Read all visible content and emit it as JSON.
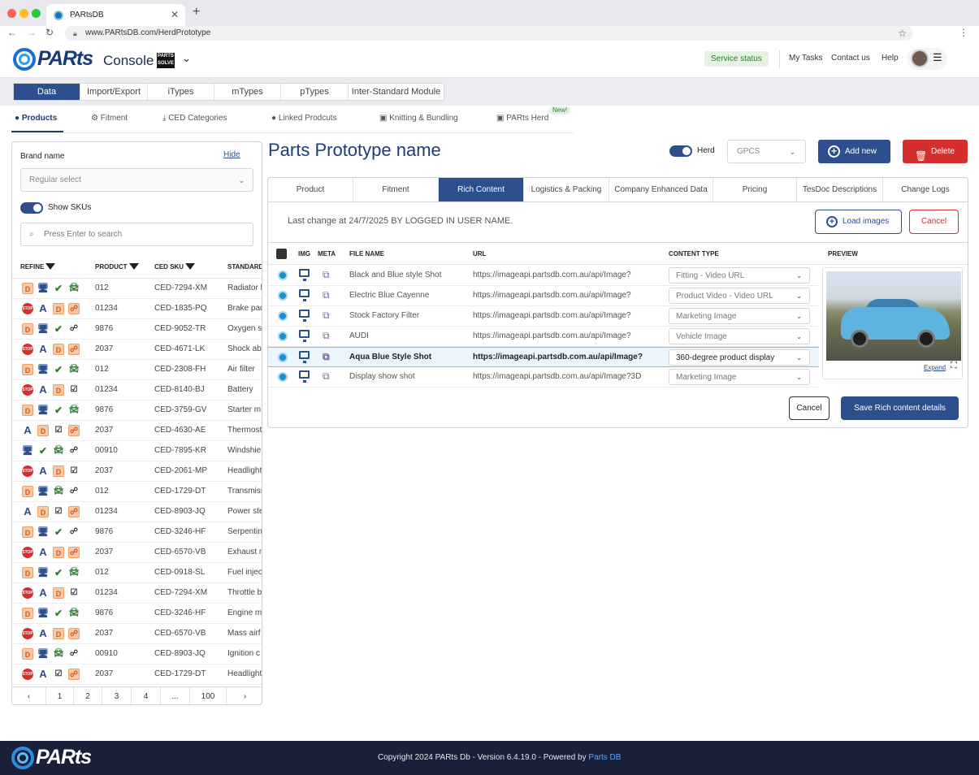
{
  "browser": {
    "tab_title": "PARtsDB",
    "url": "www.PARtsDB.com/HerdPrototype"
  },
  "header": {
    "logo": "PARts",
    "console": "Console",
    "console_badge": "PARTS SOLVE",
    "service_status": "Service status",
    "links": [
      "My Tasks",
      "Contact us",
      "Help"
    ]
  },
  "top_nav": [
    "Data",
    "Import/Export",
    "iTypes",
    "mTypes",
    "pTypes",
    "Inter-Standard Module"
  ],
  "sub_tabs": [
    "Products",
    "Fitment",
    "CED Categories",
    "Linked Prodcuts",
    "Knitting & Bundling",
    "PARts Herd"
  ],
  "new_tag": "New!",
  "left_panel": {
    "brand_label": "Brand name",
    "hide": "Hide",
    "select_placeholder": "Regular select",
    "show_skus": "Show SKUs",
    "search_placeholder": "Press Enter to search",
    "headers": [
      "REFINE",
      "PRODUCT",
      "CED SKU",
      "STANDARD"
    ],
    "rows": [
      {
        "icons": [
          "D",
          "monitor",
          "check",
          "car"
        ],
        "product": "012",
        "sku": "CED-7294-XM",
        "std": "Radiator h"
      },
      {
        "icons": [
          "stop",
          "A",
          "D",
          "net-orange"
        ],
        "product": "01234",
        "sku": "CED-1835-PQ",
        "std": "Brake pad"
      },
      {
        "icons": [
          "D",
          "monitor",
          "check",
          "net"
        ],
        "product": "9876",
        "sku": "CED-9052-TR",
        "std": "Oxygen se"
      },
      {
        "icons": [
          "stop",
          "A",
          "D",
          "net-orange"
        ],
        "product": "2037",
        "sku": "CED-4671-LK",
        "std": "Shock abs"
      },
      {
        "icons": [
          "D",
          "monitor",
          "check",
          "car"
        ],
        "product": "012",
        "sku": "CED-2308-FH",
        "std": "Air filter"
      },
      {
        "icons": [
          "stop",
          "A",
          "D",
          "sheet"
        ],
        "product": "01234",
        "sku": "CED-8140-BJ",
        "std": "Battery"
      },
      {
        "icons": [
          "D",
          "monitor",
          "check",
          "car"
        ],
        "product": "9876",
        "sku": "CED-3759-GV",
        "std": "Starter m"
      },
      {
        "icons": [
          "A",
          "D",
          "sheet",
          "net-orange"
        ],
        "product": "2037",
        "sku": "CED-4630-AE",
        "std": "Thermost"
      },
      {
        "icons": [
          "monitor",
          "check",
          "car",
          "net"
        ],
        "product": "00910",
        "sku": "CED-7895-KR",
        "std": "Windshie"
      },
      {
        "icons": [
          "stop",
          "A",
          "D",
          "sheet"
        ],
        "product": "2037",
        "sku": "CED-2061-MP",
        "std": "Headlight"
      },
      {
        "icons": [
          "D",
          "monitor",
          "car",
          "net"
        ],
        "product": "012",
        "sku": "CED-1729-DT",
        "std": "Transmiss"
      },
      {
        "icons": [
          "A",
          "D",
          "sheet",
          "net-orange"
        ],
        "product": "01234",
        "sku": "CED-8903-JQ",
        "std": "Power ste"
      },
      {
        "icons": [
          "D",
          "monitor",
          "check",
          "net"
        ],
        "product": "9876",
        "sku": "CED-3246-HF",
        "std": "Serpentin"
      },
      {
        "icons": [
          "stop",
          "A",
          "D",
          "net-orange"
        ],
        "product": "2037",
        "sku": "CED-6570-VB",
        "std": "Exhaust m"
      },
      {
        "icons": [
          "D",
          "monitor",
          "check",
          "car"
        ],
        "product": "012",
        "sku": "CED-0918-SL",
        "std": "Fuel injec"
      },
      {
        "icons": [
          "stop",
          "A",
          "D",
          "sheet"
        ],
        "product": "01234",
        "sku": "CED-7294-XM",
        "std": "Throttle b"
      },
      {
        "icons": [
          "D",
          "monitor",
          "check",
          "car"
        ],
        "product": "9876",
        "sku": "CED-3246-HF",
        "std": "Engine m"
      },
      {
        "icons": [
          "stop",
          "A",
          "D",
          "net-orange"
        ],
        "product": "2037",
        "sku": "CED-6570-VB",
        "std": "Mass airf"
      },
      {
        "icons": [
          "D",
          "monitor",
          "car",
          "net"
        ],
        "product": "00910",
        "sku": "CED-8903-JQ",
        "std": "Ignition c"
      },
      {
        "icons": [
          "stop",
          "A",
          "sheet",
          "net-orange"
        ],
        "product": "2037",
        "sku": "CED-1729-DT",
        "std": "Headlight"
      }
    ],
    "pager": [
      "‹",
      "1",
      "2",
      "3",
      "4",
      "...",
      "100",
      "›"
    ]
  },
  "main": {
    "title": "Parts Prototype name",
    "herd_label": "Herd",
    "gpcs": "GPCS",
    "add_new": "Add new",
    "delete": "Delete",
    "tabs": [
      "Product",
      "Fitment",
      "Rich Content",
      "Logistics & Packing",
      "Company Enhanced Data",
      "Pricing",
      "TesDoc Descriptions",
      "Change Logs"
    ],
    "last_change": "Last change at 24/7/2025 BY LOGGED IN USER NAME.",
    "load_images": "Load images",
    "cancel": "Cancel",
    "table_headers": [
      "IMG",
      "META",
      "FILE NAME",
      "URL",
      "CONTENT TYPE",
      "PREVIEW"
    ],
    "rows": [
      {
        "file": "Black and Blue style Shot",
        "url": "https://imageapi.partsdb.com.au/api/Image?",
        "type": "Fitting - Video URL"
      },
      {
        "file": "Electric Blue Cayenne",
        "url": "https://imageapi.partsdb.com.au/api/Image?",
        "type": "Product Video - Video URL"
      },
      {
        "file": "Stock Factory Filter",
        "url": "https://imageapi.partsdb.com.au/api/Image?",
        "type": "Marketing Image"
      },
      {
        "file": "AUDI",
        "url": "https://imageapi.partsdb.com.au/api/Image?",
        "type": "Vehicle Image"
      },
      {
        "file": "Aqua Blue Style Shot",
        "url": "https://imageapi.partsdb.com.au/api/Image?",
        "type": "360-degree product display"
      },
      {
        "file": "Display show shot",
        "url": "https://imageapi.partsdb.com.au/api/Image?3D",
        "type": "Marketing Image"
      }
    ],
    "expand": "Expand",
    "cancel2": "Cancel",
    "save": "Save Rich content details"
  },
  "footer": {
    "copyright": "Copyright 2024 PARts Db - Version 6.4.19.0 - Powered by",
    "powered": "Parts DB"
  }
}
